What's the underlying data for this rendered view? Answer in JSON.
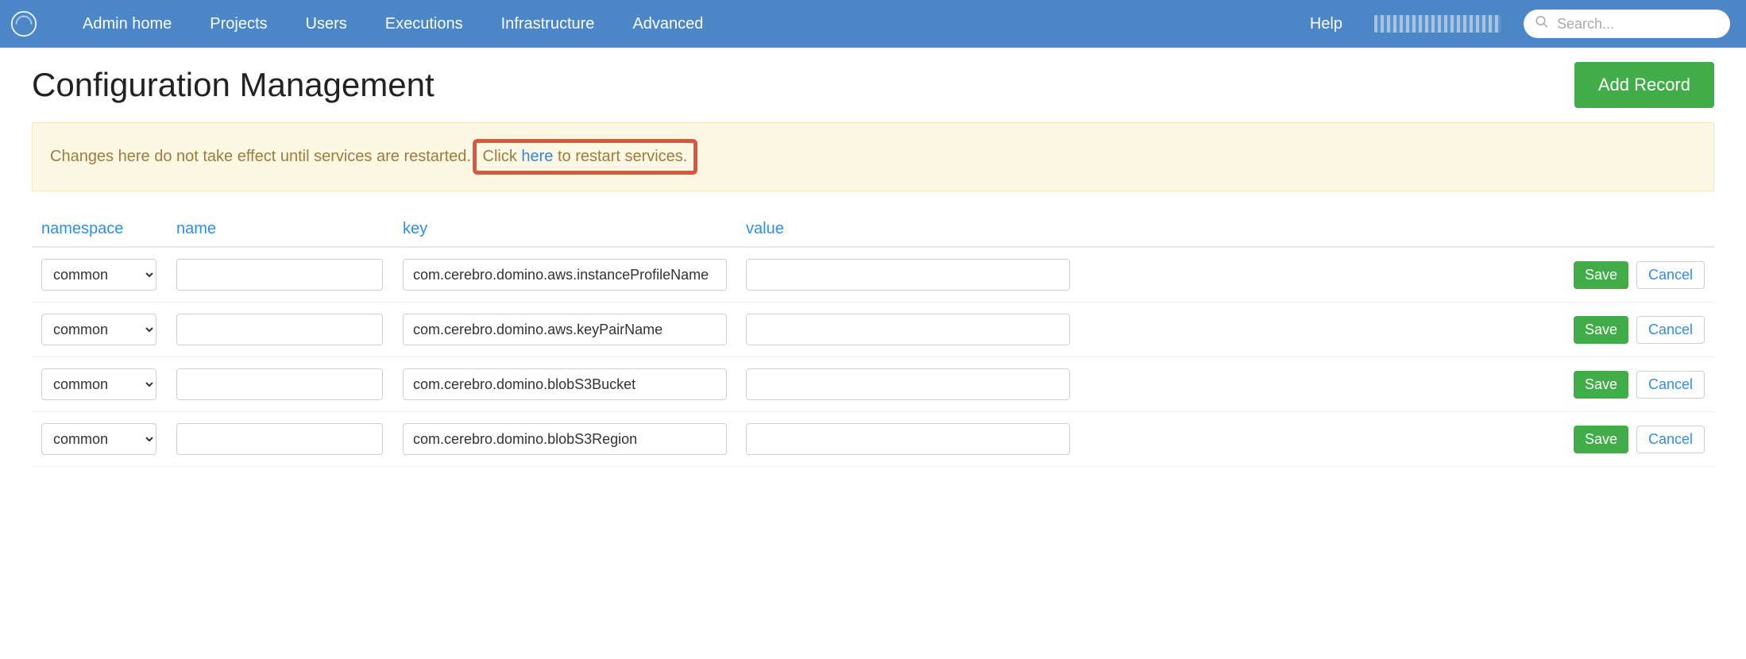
{
  "topbar": {
    "nav": {
      "admin_home": "Admin home",
      "projects": "Projects",
      "users": "Users",
      "executions": "Executions",
      "infrastructure": "Infrastructure",
      "advanced": "Advanced",
      "help": "Help"
    },
    "search_placeholder": "Search..."
  },
  "page": {
    "title": "Configuration Management",
    "add_record": "Add Record"
  },
  "alert": {
    "prefix": "Changes here do not take effect until services are restarted.",
    "box_pre": "Click ",
    "box_link": "here",
    "box_post": " to restart services."
  },
  "table": {
    "headers": {
      "namespace": "namespace",
      "name": "name",
      "key": "key",
      "value": "value"
    },
    "namespace_options": [
      "common"
    ],
    "rows": [
      {
        "namespace": "common",
        "name": "",
        "key": "com.cerebro.domino.aws.instanceProfileName",
        "value": ""
      },
      {
        "namespace": "common",
        "name": "",
        "key": "com.cerebro.domino.aws.keyPairName",
        "value": ""
      },
      {
        "namespace": "common",
        "name": "",
        "key": "com.cerebro.domino.blobS3Bucket",
        "value": ""
      },
      {
        "namespace": "common",
        "name": "",
        "key": "com.cerebro.domino.blobS3Region",
        "value": ""
      }
    ],
    "buttons": {
      "save": "Save",
      "cancel": "Cancel"
    }
  }
}
